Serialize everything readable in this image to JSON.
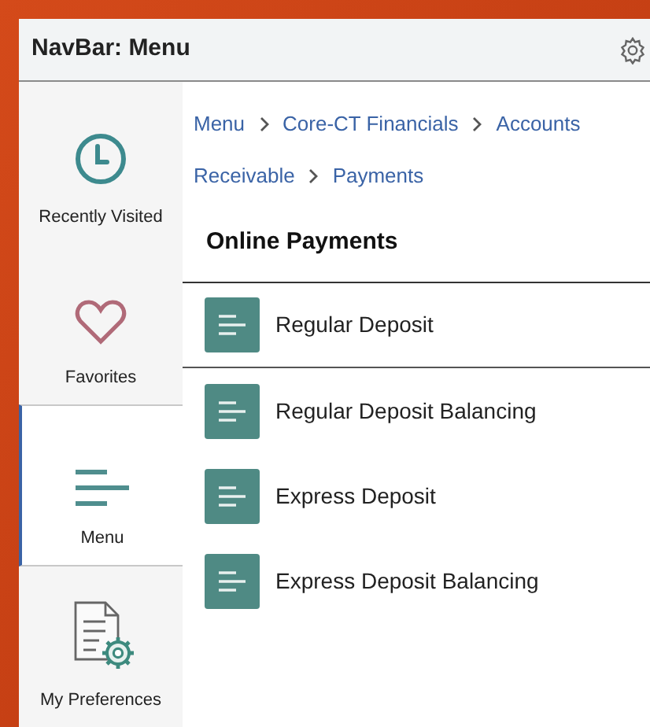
{
  "header": {
    "title": "NavBar: Menu"
  },
  "sidebar": {
    "items": [
      {
        "label": "Recently Visited",
        "kind": "clock",
        "selected": false
      },
      {
        "label": "Favorites",
        "kind": "heart",
        "selected": false
      },
      {
        "label": "Menu",
        "kind": "menu",
        "selected": true
      },
      {
        "label": "My Preferences",
        "kind": "prefs",
        "selected": false
      }
    ]
  },
  "breadcrumb": {
    "lines": [
      [
        "Menu",
        "Core-CT Financials",
        "Accounts"
      ],
      [
        "Receivable",
        "Payments"
      ]
    ]
  },
  "section": {
    "title": "Online Payments"
  },
  "items": [
    {
      "label": "Regular Deposit",
      "selected": true
    },
    {
      "label": "Regular Deposit Balancing",
      "selected": false
    },
    {
      "label": "Express Deposit",
      "selected": false
    },
    {
      "label": "Express Deposit Balancing",
      "selected": false
    }
  ]
}
